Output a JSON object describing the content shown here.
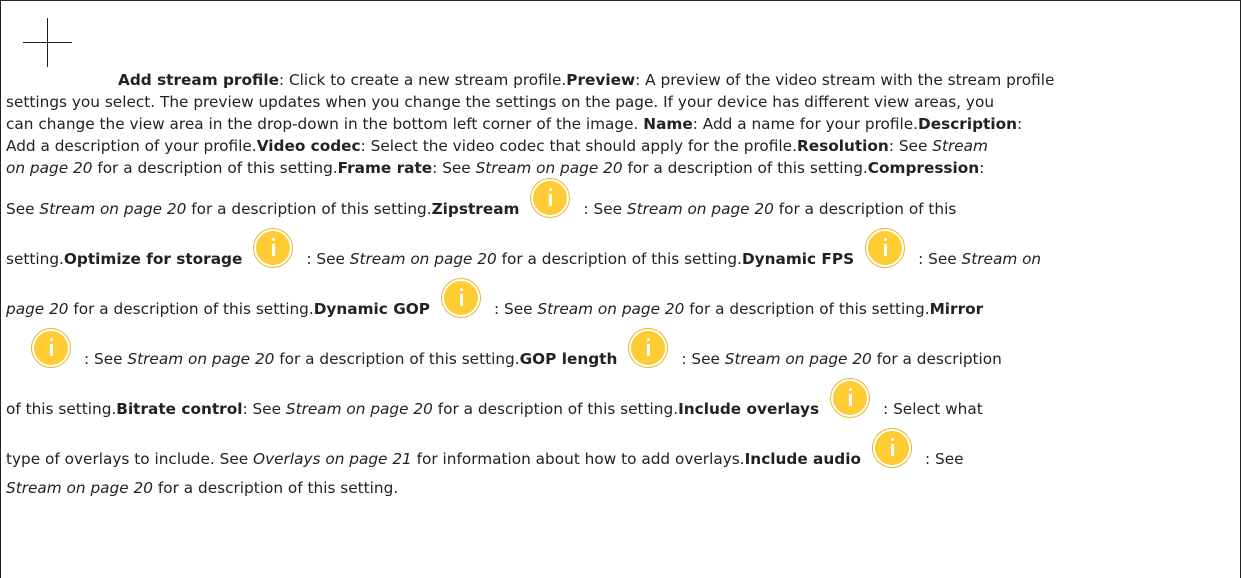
{
  "add_icon": "plus-icon",
  "info_icon": "info-icon",
  "accent": "#ffcc33",
  "add": {
    "title": "Add stream profile",
    "desc": ": Click to create a new stream profile."
  },
  "preview": {
    "title": "Preview",
    "desc_1": ": A preview of the video stream with the stream profile",
    "desc_2": "settings you select. The preview updates when you change the settings on the page. If your device has different view areas, you",
    "desc_3": "can change the view area in the drop-down in the bottom left corner of the image. "
  },
  "name": {
    "title": "Name",
    "desc": ": Add a name for your profile."
  },
  "description": {
    "title": "Description",
    "desc_1": ":",
    "desc_2": "Add a description of your profile."
  },
  "video_codec": {
    "title": "Video codec",
    "desc": ": Select the video codec that should apply for the profile."
  },
  "resolution": {
    "title": "Resolution",
    "see": ": See ",
    "link_1": "Stream",
    "link_2": "on page 20",
    "tail": " for a description of this setting."
  },
  "frame_rate": {
    "title": "Frame rate",
    "see": ": See ",
    "link": "Stream on page 20",
    "tail": " for a description of this setting."
  },
  "compression": {
    "title": "Compression",
    "colon": ":",
    "see": "See ",
    "link": "Stream on page 20",
    "tail": " for a description of this setting."
  },
  "zipstream": {
    "title": "Zipstream",
    "see": ": See ",
    "link": "Stream on page 20",
    "tail": " for a description of this",
    "tail_2": "setting."
  },
  "optimize": {
    "title": "Optimize for storage",
    "see": ": See ",
    "link": "Stream on page 20",
    "tail": " for a description of this setting."
  },
  "dynamic_fps": {
    "title": "Dynamic FPS",
    "see": ": See ",
    "link_1": "Stream on",
    "link_2": "page 20",
    "tail": " for a description of this setting."
  },
  "dynamic_gop": {
    "title": "Dynamic GOP",
    "see": ": See ",
    "link": "Stream on page 20",
    "tail": " for a description of this setting."
  },
  "mirror": {
    "title": "Mirror",
    "see": ": See ",
    "link": "Stream on page 20",
    "tail": " for a description of this setting."
  },
  "gop_length": {
    "title": "GOP length",
    "see": ": See ",
    "link": "Stream on page 20",
    "tail": " for a description",
    "tail_2": "of this setting."
  },
  "bitrate": {
    "title": "Bitrate control",
    "see": ": See ",
    "link": "Stream on page 20",
    "tail": " for a description of this setting."
  },
  "overlays": {
    "title": "Include overlays",
    "desc": ": Select what",
    "desc_2": "type of overlays to include. See ",
    "link": "Overlays on page 21",
    "tail": " for information about how to add overlays."
  },
  "audio": {
    "title": "Include audio",
    "see": ": See",
    "link": "Stream on page 20",
    "tail": " for a description of this setting."
  }
}
